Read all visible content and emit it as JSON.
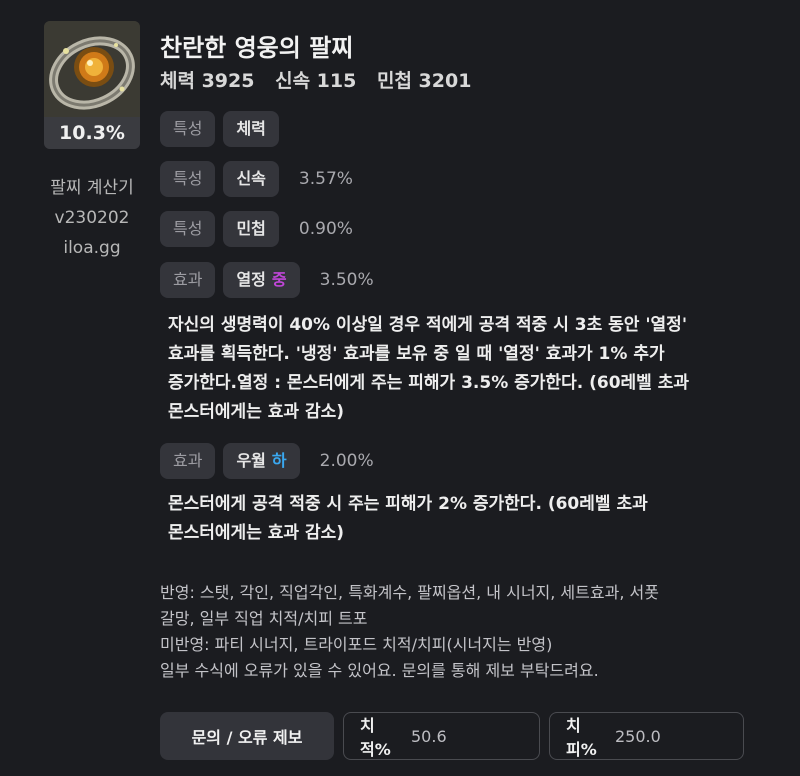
{
  "item": {
    "percent": "10.3%",
    "name": "찬란한 영웅의 팔찌",
    "stats": [
      "체력 3925",
      "신속 115",
      "민첩 3201"
    ],
    "icon": "bracelet-icon"
  },
  "app": {
    "title": "팔찌 계산기",
    "version": "v230202",
    "site": "iloa.gg"
  },
  "rows": [
    {
      "type": "특성",
      "name": "체력",
      "grade": "",
      "value": ""
    },
    {
      "type": "특성",
      "name": "신속",
      "grade": "",
      "value": "3.57%"
    },
    {
      "type": "특성",
      "name": "민첩",
      "grade": "",
      "value": "0.90%"
    },
    {
      "type": "효과",
      "name": "열정",
      "grade": "중",
      "value": "3.50%"
    },
    {
      "type": "효과",
      "name": "우월",
      "grade": "하",
      "value": "2.00%"
    }
  ],
  "descriptions": {
    "effect1": [
      "자신의 생명력이 40% 이상일 경우 적에게 공격 적중 시 3초 동안 '열정'",
      "효과를 획득한다. '냉정' 효과를 보유 중 일 때 '열정' 효과가 1% 추가",
      "증가한다.열정 : 몬스터에게 주는 피해가 3.5% 증가한다. (60레벨 초과",
      "몬스터에게는 효과 감소)"
    ],
    "effect2": [
      "몬스터에게 공격 적중 시 주는 피해가 2% 증가한다. (60레벨 초과",
      "몬스터에게는 효과 감소)"
    ]
  },
  "notes": [
    "반영: 스탯, 각인, 직업각인, 특화계수, 팔찌옵션, 내 시너지, 세트효과, 서폿",
    "갈망, 일부 직업 치적/치피 트포",
    "미반영: 파티 시너지, 트라이포드 치적/치피(시너지는 반영)",
    "일부 수식에 오류가 있을 수 있어요. 문의를 통해 제보 부탁드려요."
  ],
  "footer": {
    "report_label": "문의 / 오류 제보",
    "crit_rate_label": "치적%",
    "crit_rate_value": "50.6",
    "crit_dmg_label": "치피%",
    "crit_dmg_value": "250.0"
  },
  "colors": {
    "grade_mid": "#c046d8",
    "grade_low": "#3aa8f0",
    "background": "#1b1c20"
  }
}
